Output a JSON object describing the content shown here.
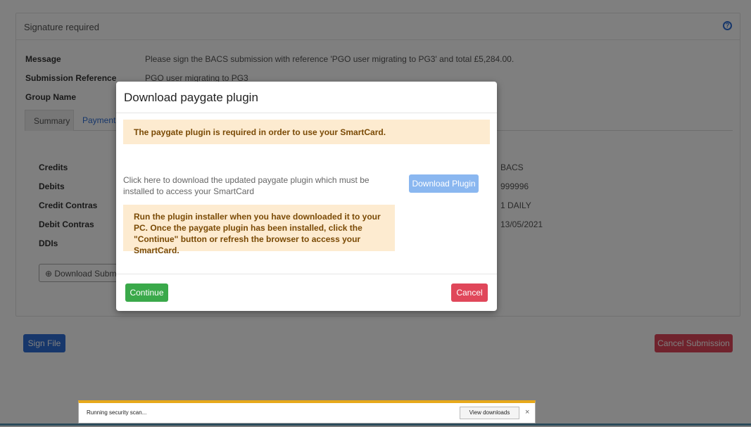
{
  "panel": {
    "title": "Signature required",
    "help_icon": "?",
    "fields": [
      {
        "label": "Message",
        "value": "Please sign the BACS submission with reference 'PGO user migrating to PG3' and total £5,284.00."
      },
      {
        "label": "Submission Reference",
        "value": "PGO user migrating to PG3"
      },
      {
        "label": "Group Name",
        "value": ""
      }
    ],
    "tabs": [
      {
        "label": "Summary"
      },
      {
        "label": "Payments"
      }
    ],
    "summary_labels": [
      "Credits",
      "Debits",
      "Credit Contras",
      "Debit Contras",
      "DDIs"
    ],
    "summary_values": [
      "BACS",
      "999996",
      "1 DAILY",
      "13/05/2021"
    ],
    "download_submission_label": "⊕ Download Submission"
  },
  "actions": {
    "sign_file": "Sign File",
    "cancel_submission": "Cancel Submission"
  },
  "modal": {
    "title": "Download paygate plugin",
    "alert_required": "The paygate plugin is required in order to use your SmartCard.",
    "download_text": "Click here to download the updated paygate plugin which must be installed to access your SmartCard",
    "download_button": "Download Plugin",
    "instructions": "Run the plugin installer when you have downloaded it to your PC. Once the paygate plugin has been installed, click the \"Continue\" button or refresh the browser to access your SmartCard.",
    "continue_button": "Continue",
    "cancel_button": "Cancel"
  },
  "download_bar": {
    "status": "Running security scan...",
    "view_downloads": "View downloads",
    "close": "×"
  },
  "colors": {
    "primary": "#2f6fd6",
    "danger": "#e0475a",
    "success": "#3aa94a",
    "warning_bg": "#fdebd0",
    "warning_text": "#7a4a05"
  }
}
